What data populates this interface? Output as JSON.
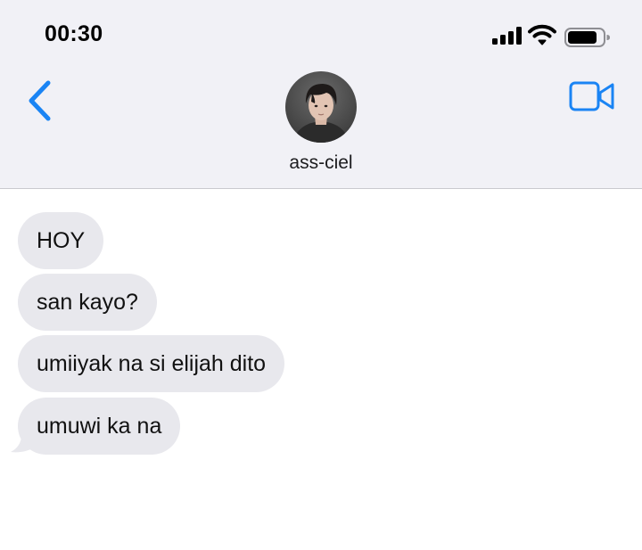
{
  "status_bar": {
    "time": "00:30",
    "icons": [
      "signal-icon",
      "wifi-icon",
      "battery-icon"
    ]
  },
  "nav": {
    "back_icon": "chevron-left-icon",
    "video_icon": "video-camera-icon",
    "contact_name": "ass-ciel",
    "accent_color": "#1a84f4"
  },
  "messages": [
    {
      "text": "HOY",
      "direction": "incoming"
    },
    {
      "text": "san kayo?",
      "direction": "incoming"
    },
    {
      "text": "umiiyak na si elijah dito",
      "direction": "incoming"
    },
    {
      "text": "umuwi ka na",
      "direction": "incoming"
    }
  ],
  "colors": {
    "header_bg": "#f1f1f6",
    "incoming_bubble": "#e8e8ed"
  }
}
